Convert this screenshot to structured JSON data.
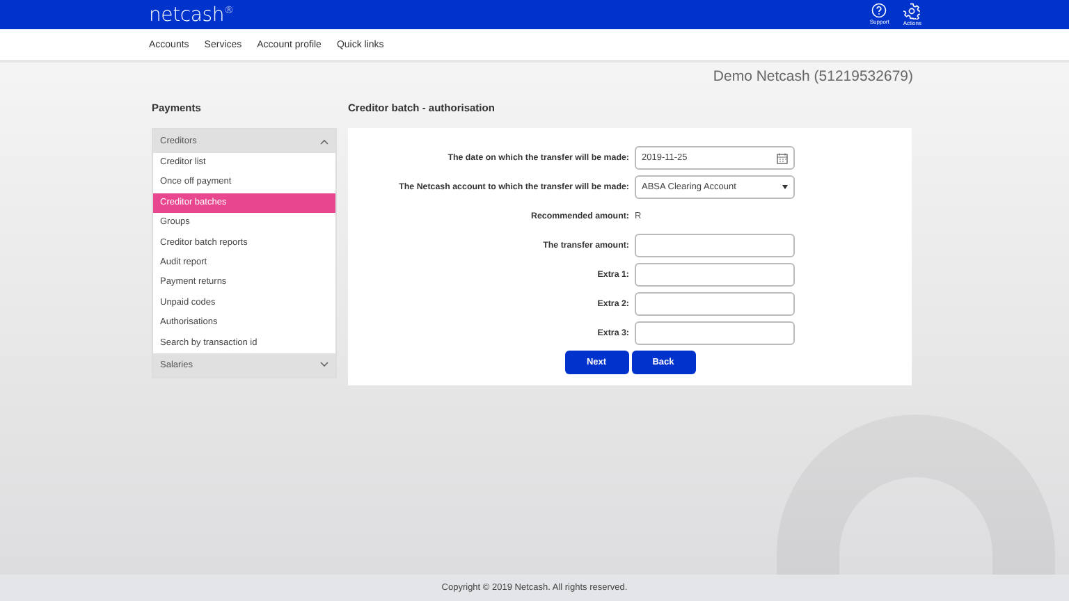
{
  "header": {
    "logo": "netcash$^{®}$",
    "actions": [
      {
        "label": "Support",
        "kind": "help"
      },
      {
        "label": "Actions",
        "kind": "gear"
      }
    ]
  },
  "nav": [
    "Accounts",
    "Services",
    "Account profile",
    "Quick links"
  ],
  "account": "Demo Netcash (51219532679)",
  "sidebar": {
    "title": "Payments",
    "groups": [
      {
        "label": "Creditors",
        "expanded": true,
        "items": [
          {
            "label": "Creditor list",
            "selected": false
          },
          {
            "label": "Once off payment",
            "selected": false
          },
          {
            "label": "Creditor batches",
            "selected": true
          },
          {
            "label": "Groups",
            "selected": false
          },
          {
            "label": "Creditor batch reports",
            "selected": false
          },
          {
            "label": "Audit report",
            "selected": false
          },
          {
            "label": "Payment returns",
            "selected": false
          },
          {
            "label": "Unpaid codes",
            "selected": false
          },
          {
            "label": "Authorisations",
            "selected": false
          },
          {
            "label": "Search by transaction id",
            "selected": false
          }
        ]
      },
      {
        "label": "Salaries",
        "expanded": false
      }
    ]
  },
  "page_title": "Creditor batch - authorisation",
  "form": {
    "fields": [
      {
        "label": "The date on which the transfer will be made:",
        "kind": "date",
        "value": "2019-11-25"
      },
      {
        "label": "The Netcash account to which the transfer will be made:",
        "kind": "select",
        "value": "ABSA Clearing Account"
      },
      {
        "label": "Recommended amount:",
        "kind": "text",
        "value": "R"
      },
      {
        "label": "The transfer amount:",
        "kind": "input"
      },
      {
        "label": "Extra 1:",
        "kind": "input"
      },
      {
        "label": "Extra 2:",
        "kind": "input"
      },
      {
        "label": "Extra 3:",
        "kind": "input"
      }
    ],
    "buttons": [
      "Next",
      "Back"
    ]
  },
  "footer": "Copyright © 2019 Netcash. All rights reserved."
}
